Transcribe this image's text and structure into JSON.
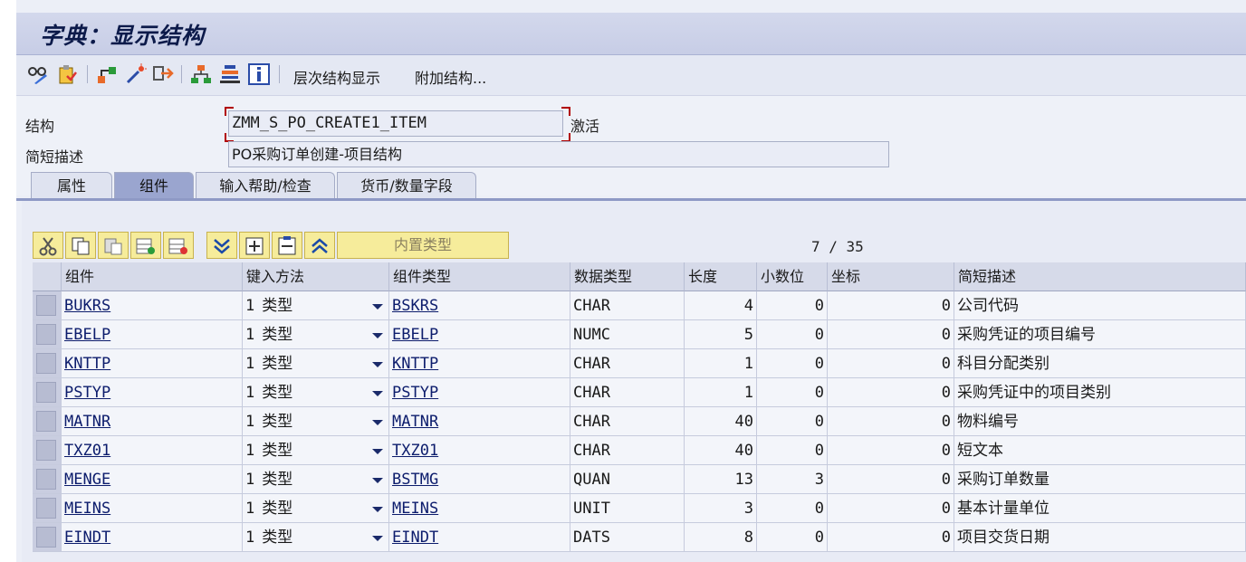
{
  "window": {
    "title": "字典：显示结构"
  },
  "toolbar": {
    "icons": [
      "glasses-pen-icon",
      "clipboard-check-icon",
      "hierarchy-icon",
      "magic-wand-icon",
      "transport-icon",
      "org-chart-icon",
      "stack-icon",
      "info-icon"
    ],
    "hierarchy_label": "层次结构显示",
    "append_label": "附加结构..."
  },
  "form": {
    "structure_label": "结构",
    "structure_value": "ZMM_S_PO_CREATE1_ITEM",
    "status": "激活",
    "desc_label": "简短描述",
    "desc_value": "PO采购订单创建-项目结构"
  },
  "tabs": [
    {
      "label": "属性",
      "active": false
    },
    {
      "label": "组件",
      "active": true
    },
    {
      "label": "输入帮助/检查",
      "active": false
    },
    {
      "label": "货币/数量字段",
      "active": false
    }
  ],
  "grid_toolbar": {
    "builtin_type_label": "内置类型",
    "counter": "7 / 35"
  },
  "columns": [
    "组件",
    "键入方法",
    "组件类型",
    "数据类型",
    "长度",
    "小数位",
    "坐标",
    "简短描述"
  ],
  "rows": [
    {
      "component": "BUKRS",
      "entry": "1",
      "entry_kind": "类型",
      "comp_type": "BSKRS",
      "data_type": "CHAR",
      "length": "4",
      "decimals": "0",
      "coord": "0",
      "desc": "公司代码"
    },
    {
      "component": "EBELP",
      "entry": "1",
      "entry_kind": "类型",
      "comp_type": "EBELP",
      "data_type": "NUMC",
      "length": "5",
      "decimals": "0",
      "coord": "0",
      "desc": "采购凭证的项目编号"
    },
    {
      "component": "KNTTP",
      "entry": "1",
      "entry_kind": "类型",
      "comp_type": "KNTTP",
      "data_type": "CHAR",
      "length": "1",
      "decimals": "0",
      "coord": "0",
      "desc": "科目分配类别"
    },
    {
      "component": "PSTYP",
      "entry": "1",
      "entry_kind": "类型",
      "comp_type": "PSTYP",
      "data_type": "CHAR",
      "length": "1",
      "decimals": "0",
      "coord": "0",
      "desc": "采购凭证中的项目类别"
    },
    {
      "component": "MATNR",
      "entry": "1",
      "entry_kind": "类型",
      "comp_type": "MATNR",
      "data_type": "CHAR",
      "length": "40",
      "decimals": "0",
      "coord": "0",
      "desc": "物料编号"
    },
    {
      "component": "TXZ01",
      "entry": "1",
      "entry_kind": "类型",
      "comp_type": "TXZ01",
      "data_type": "CHAR",
      "length": "40",
      "decimals": "0",
      "coord": "0",
      "desc": "短文本"
    },
    {
      "component": "MENGE",
      "entry": "1",
      "entry_kind": "类型",
      "comp_type": "BSTMG",
      "data_type": "QUAN",
      "length": "13",
      "decimals": "3",
      "coord": "0",
      "desc": "采购订单数量"
    },
    {
      "component": "MEINS",
      "entry": "1",
      "entry_kind": "类型",
      "comp_type": "MEINS",
      "data_type": "UNIT",
      "length": "3",
      "decimals": "0",
      "coord": "0",
      "desc": "基本计量单位"
    },
    {
      "component": "EINDT",
      "entry": "1",
      "entry_kind": "类型",
      "comp_type": "EINDT",
      "data_type": "DATS",
      "length": "8",
      "decimals": "0",
      "coord": "0",
      "desc": "项目交货日期"
    }
  ]
}
